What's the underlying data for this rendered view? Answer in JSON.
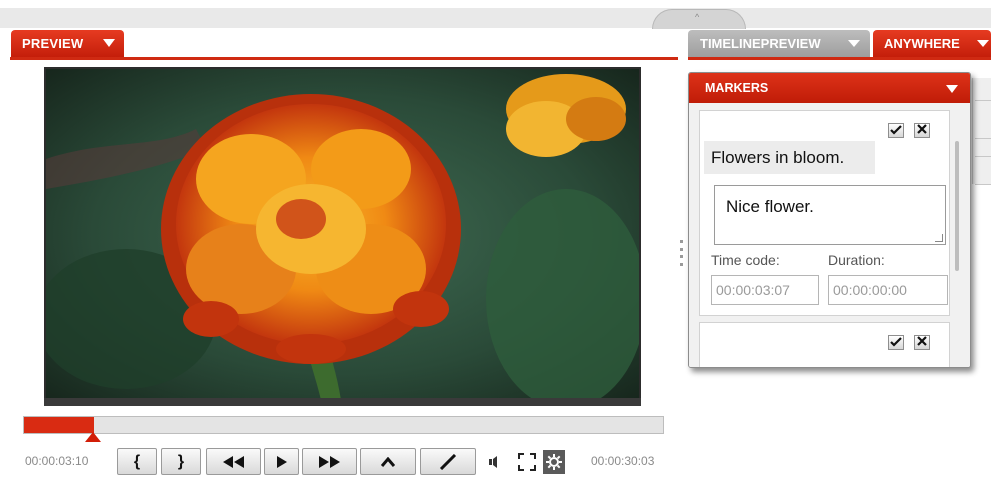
{
  "tabs": {
    "preview": "PREVIEW",
    "timeline_preview": "TIMELINEPREVIEW",
    "anywhere": "ANYWHERE"
  },
  "player": {
    "current_time": "00:00:03:10",
    "total_time": "00:00:30:03",
    "progress_fraction": 0.11,
    "buttons": {
      "mark_in": "{",
      "mark_out": "}"
    }
  },
  "markers": {
    "header": "MARKERS",
    "items": [
      {
        "title": "Flowers in bloom.",
        "comment": "Nice flower.",
        "time_code_label": "Time code:",
        "time_code": "00:00:03:07",
        "duration_label": "Duration:",
        "duration": "00:00:00:00"
      }
    ]
  },
  "colors": {
    "accent_red": "#cf2a12",
    "tab_grey": "#a8a8a8"
  }
}
